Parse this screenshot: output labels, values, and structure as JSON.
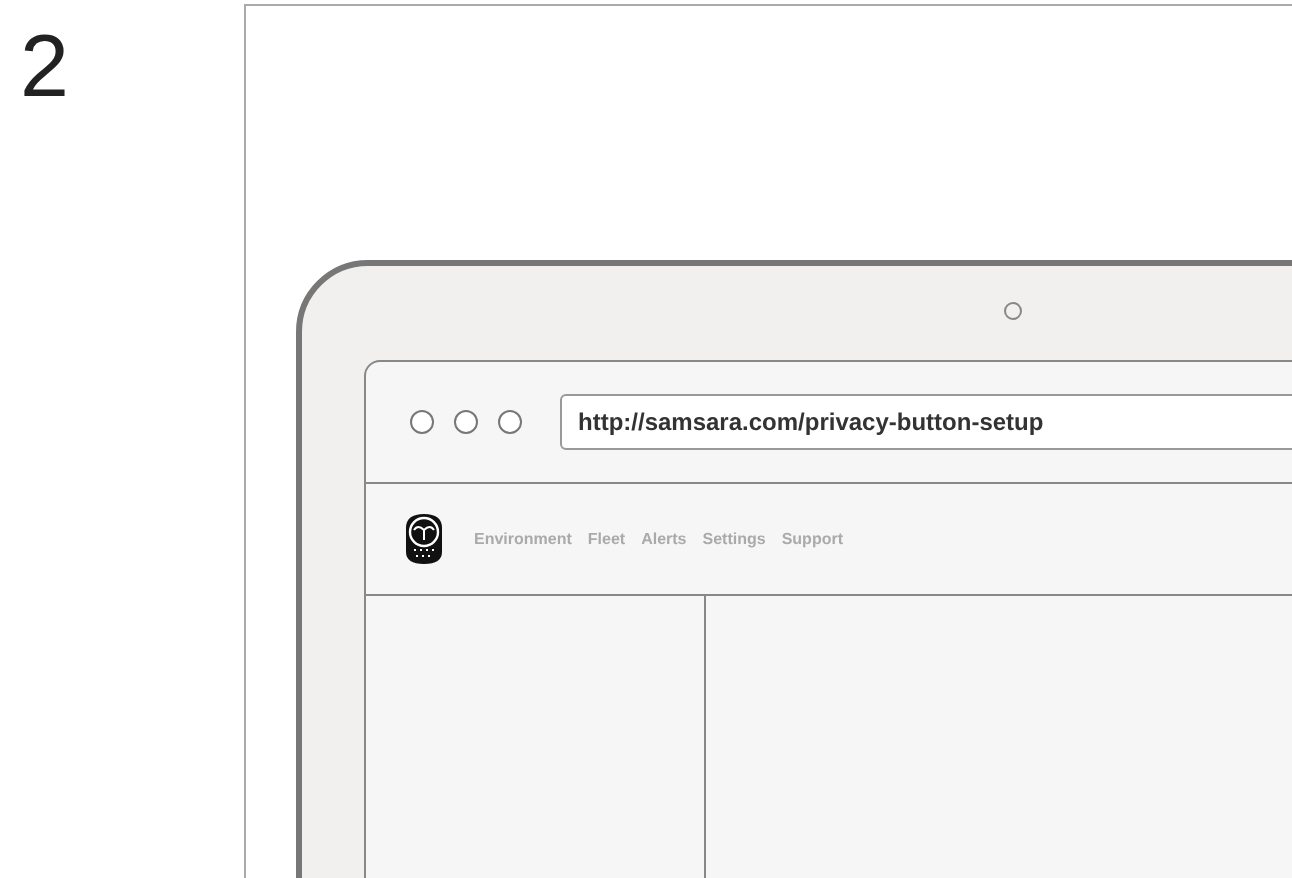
{
  "step_number": "2",
  "browser": {
    "url": "http://samsara.com/privacy-button-setup"
  },
  "nav": {
    "items": [
      {
        "label": "Environment"
      },
      {
        "label": "Fleet"
      },
      {
        "label": "Alerts"
      },
      {
        "label": "Settings"
      },
      {
        "label": "Support"
      }
    ]
  }
}
